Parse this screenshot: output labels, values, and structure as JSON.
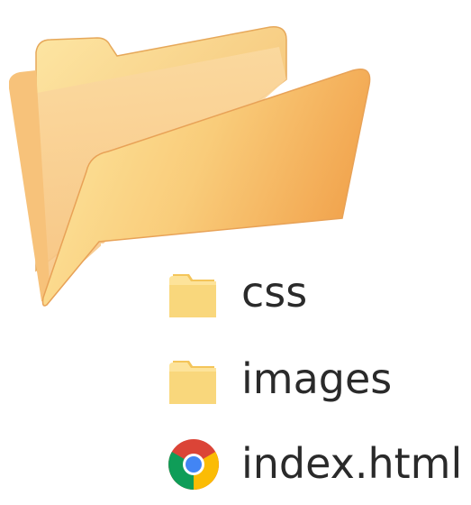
{
  "explorer": {
    "items": [
      {
        "name": "css",
        "kind": "folder",
        "icon": "folder-icon"
      },
      {
        "name": "images",
        "kind": "folder",
        "icon": "folder-icon"
      },
      {
        "name": "index.html",
        "kind": "file",
        "icon": "chrome-icon"
      }
    ]
  },
  "colors": {
    "folder_light": "#fde49a",
    "folder_dark": "#f3a54d",
    "text": "#2a2a2a"
  }
}
